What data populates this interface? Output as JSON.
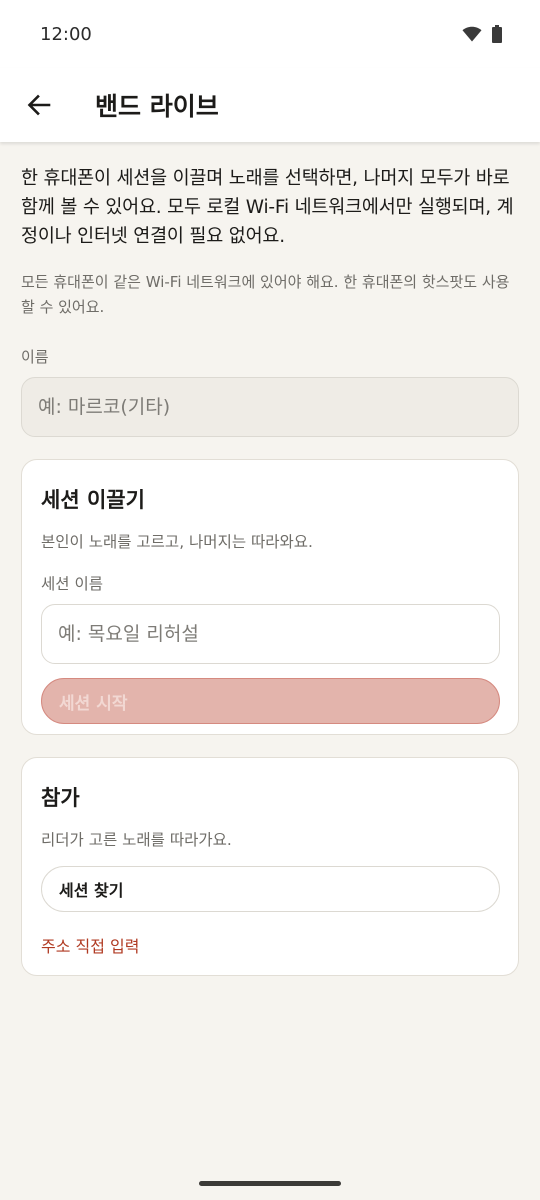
{
  "status_bar": {
    "time": "12:00",
    "icons": [
      "wifi-icon",
      "battery-icon"
    ]
  },
  "app_bar": {
    "back_icon": "back-arrow-icon",
    "title": "밴드 라이브"
  },
  "intro": {
    "description": "한 휴대폰이 세션을 이끌며 노래를 선택하면, 나머지 모두가 바로 함께 볼 수 있어요. 모두 로컬 Wi-Fi 네트워크에서만 실행되며, 계정이나 인터넷 연결이 필요 없어요.",
    "note": "모든 휴대폰이 같은 Wi-Fi 네트워크에 있어야 해요. 한 휴대폰의 핫스팟도 사용할 수 있어요."
  },
  "name_field": {
    "label": "이름",
    "placeholder": "예: 마르코(기타)",
    "value": ""
  },
  "lead_card": {
    "title": "세션 이끌기",
    "subtitle": "본인이 노래를 고르고, 나머지는 따라와요.",
    "session_label": "세션 이름",
    "session_placeholder": "예: 목요일 리허설",
    "session_value": "",
    "start_button": "세션 시작"
  },
  "join_card": {
    "title": "참가",
    "subtitle": "리더가 고른 노래를 따라가요.",
    "find_button": "세션 찾기",
    "manual_link": "주소 직접 입력"
  },
  "colors": {
    "background": "#f6f4ef",
    "accent": "#b03a22",
    "disabled_button": "#e3b4ac"
  }
}
